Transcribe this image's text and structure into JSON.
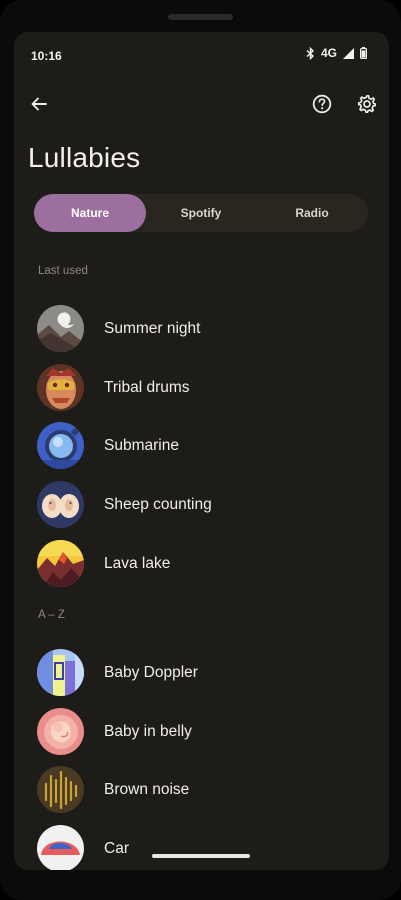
{
  "status_bar": {
    "time": "10:16",
    "network": "4G",
    "icons": [
      "bluetooth-icon",
      "signal-icon",
      "battery-icon"
    ]
  },
  "app_bar": {
    "back_icon": "arrow-back-icon",
    "help_icon": "help-circle-icon",
    "settings_icon": "gear-icon"
  },
  "title": "Lullabies",
  "tabs": [
    {
      "label": "Nature",
      "active": true
    },
    {
      "label": "Spotify",
      "active": false
    },
    {
      "label": "Radio",
      "active": false
    }
  ],
  "sections": {
    "last_used": {
      "header": "Last used",
      "items": [
        {
          "label": "Summer night"
        },
        {
          "label": "Tribal drums"
        },
        {
          "label": "Submarine"
        },
        {
          "label": "Sheep counting"
        },
        {
          "label": "Lava lake"
        }
      ]
    },
    "a_z": {
      "header": "A – Z",
      "items": [
        {
          "label": "Baby Doppler"
        },
        {
          "label": "Baby in belly"
        },
        {
          "label": "Brown noise"
        },
        {
          "label": "Car"
        }
      ]
    }
  },
  "colors": {
    "background": "#1d1c18",
    "accent": "#9d6f9f",
    "segment_bg": "#28261f"
  }
}
